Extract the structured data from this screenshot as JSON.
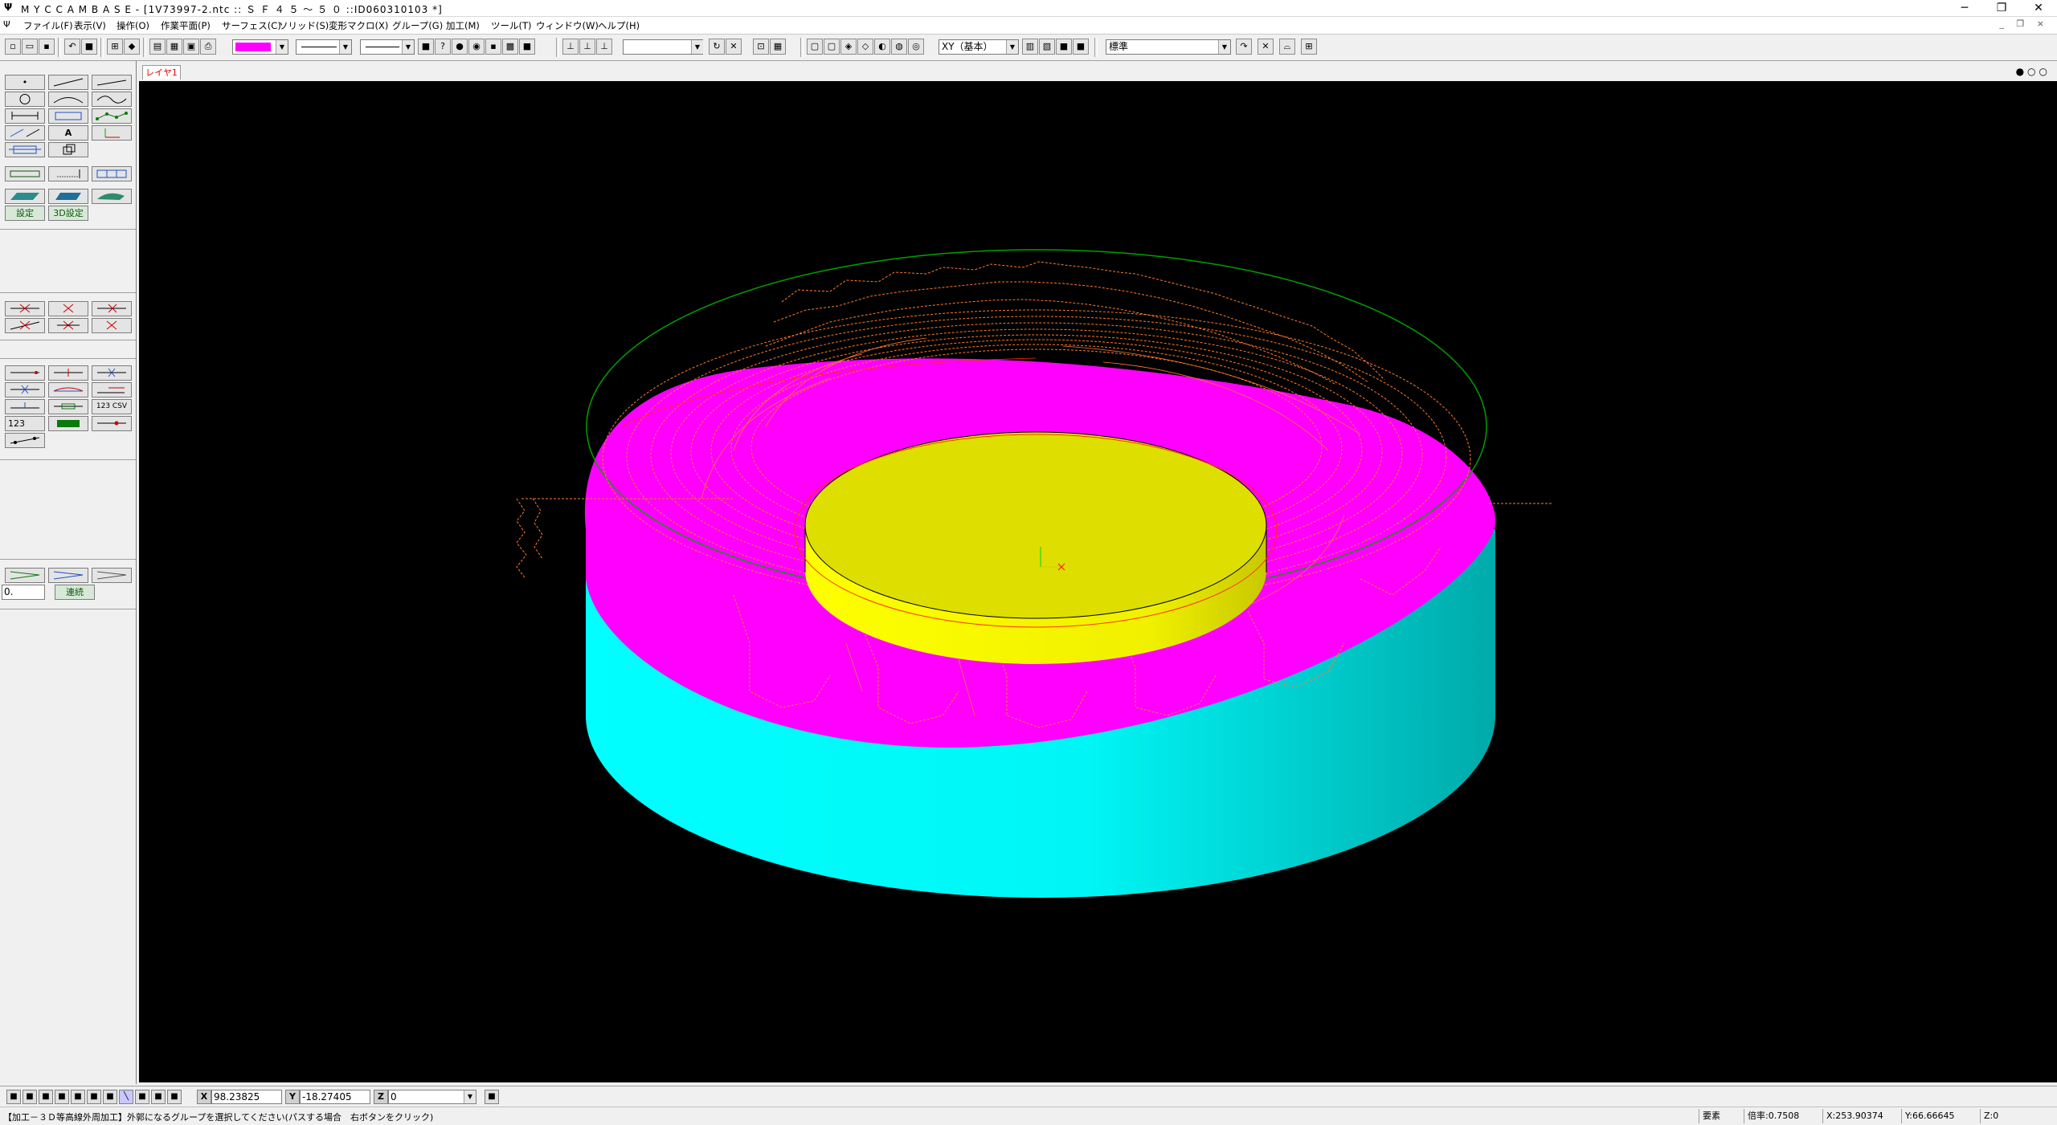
{
  "window": {
    "app_icon": "cam-app-icon",
    "title": "M Y C  C A M B A S E - [1V73997-2.ntc :: Ｓ Ｆ ４ ５ ～ ５ ０ ::ID060310103 *]",
    "minimize": "─",
    "restore": "❐",
    "close": "✕"
  },
  "menu": {
    "items": [
      "ファイル(F)",
      "表示(V)",
      "操作(O)",
      "作業平面(P)",
      "サーフェス(C)",
      "ソリッド(S)",
      "変形マクロ(X)",
      "グループ(G)",
      "加工(M)",
      "ツール(T)",
      "ウィンドウ(W)",
      "ヘルプ(H)"
    ],
    "mdi_controls": "_ ❐ ×"
  },
  "toolbar": {
    "color_combo_value": "",
    "plane_combo_value": "XY（基本）",
    "style_combo_value": "標準",
    "empty_combo_value": ""
  },
  "tabs": {
    "layer_tab": "レイヤ1",
    "view_ctrls": "●○○"
  },
  "left_panel": {
    "point_label": "•",
    "text_a": "A",
    "settings_label": "設定",
    "settings_3d_label": "3D設定",
    "number_label": "123",
    "number_csv_label": "123 CSV",
    "continuous_label": "連続",
    "value_field": "0."
  },
  "coords": {
    "x_label": "X",
    "x_value": "98.23825",
    "y_label": "Y",
    "y_value": "-18.27405",
    "z_label": "Z",
    "z_value": "0"
  },
  "status": {
    "message": "【加工－３Ｄ等高線外周加工】外郭になるグループを選択してください(パスする場合　右ボタンをクリック)",
    "field1": "要素",
    "field2": "倍率:0.7508",
    "field3": "X:253.90374",
    "field4": "Y:66.66645",
    "field5": "Z:0"
  },
  "colors": {
    "viewport_bg": "#000000",
    "base_cylinder": "#00ffff",
    "middle_surface": "#ff00ff",
    "top_cylinder": "#ffff00",
    "toolpath": "#ff7a30",
    "outline_circle": "#00a000",
    "tab_text": "#e00000"
  }
}
